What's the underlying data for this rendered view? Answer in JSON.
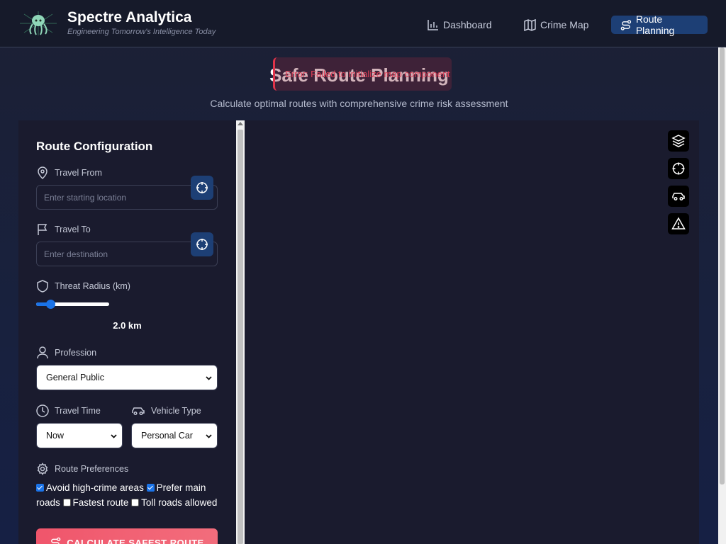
{
  "header": {
    "brand_title": "Spectre Analytica",
    "brand_subtitle": "Engineering Tomorrow's Intelligence Today",
    "logo_icon": "octopus-logo",
    "nav": [
      {
        "label": "Dashboard",
        "icon": "bar-chart-icon",
        "active": false
      },
      {
        "label": "Crime Map",
        "icon": "map-icon",
        "active": false
      },
      {
        "label": "Route Planning",
        "icon": "route-icon",
        "active": true
      }
    ]
  },
  "hero": {
    "title": "Safe Route Planning",
    "subtitle": "Calculate optimal routes with comprehensive crime risk assessment",
    "toast": "Error: Failed to initialize map component"
  },
  "panel": {
    "title": "Route Configuration",
    "travel_from": {
      "label": "Travel From",
      "placeholder": "Enter starting location",
      "value": ""
    },
    "travel_to": {
      "label": "Travel To",
      "placeholder": "Enter destination",
      "value": ""
    },
    "threat_radius": {
      "label": "Threat Radius (km)",
      "value_text": "2.0 km",
      "fraction": 0.2
    },
    "profession": {
      "label": "Profession",
      "selected": "General Public"
    },
    "travel_time": {
      "label": "Travel Time",
      "selected": "Now"
    },
    "vehicle_type": {
      "label": "Vehicle Type",
      "selected": "Personal Car"
    },
    "preferences": {
      "label": "Route Preferences",
      "options": [
        {
          "label": "Avoid high-crime areas",
          "checked": true
        },
        {
          "label": "Prefer main roads",
          "checked": true
        },
        {
          "label": "Fastest route",
          "checked": false
        },
        {
          "label": "Toll roads allowed",
          "checked": false
        }
      ]
    },
    "calculate_button": "CALCULATE SAFEST ROUTE"
  },
  "map_controls": [
    "layers-icon",
    "locate-icon",
    "car-icon",
    "warning-icon"
  ],
  "colors": {
    "accent": "#1d3f75",
    "danger": "#f0556b",
    "slider": "#1a73e8"
  }
}
